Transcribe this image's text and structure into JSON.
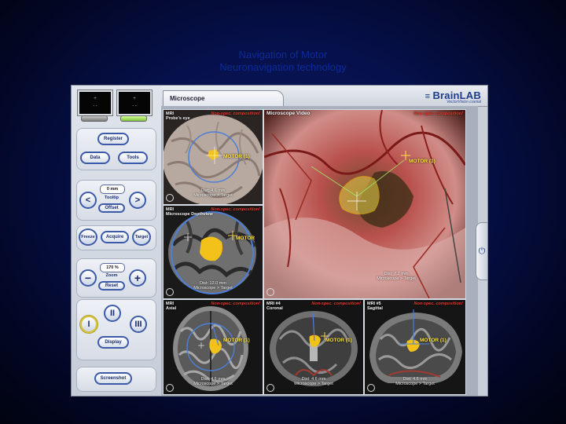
{
  "slide": {
    "caption_line1": "Navigation of Motor",
    "caption_line2": "Neuronavigation technology"
  },
  "app": {
    "brand_name": "BrainLAB",
    "brand_sub": "VectorVision cranial",
    "active_tab": "Microscope"
  },
  "left_panel": {
    "register_label": "Register",
    "data_label": "Data",
    "tools_label": "Tools",
    "tooltip_value": "0 mm",
    "tooltip_label": "Tooltip",
    "offset_label": "Offset",
    "freeze_label": "Freeze",
    "acquire_label": "Acquire",
    "target_label": "Target",
    "zoom_value": "170 %",
    "zoom_label": "Zoom",
    "reset_label": "Reset",
    "layout_1": "I",
    "layout_2": "II",
    "layout_3": "III",
    "display_label": "Display",
    "screenshot_label": "Screenshot",
    "minus_symbol": "−",
    "plus_symbol": "+",
    "left_arrow": "<",
    "right_arrow": ">"
  },
  "panes": {
    "pane1": {
      "title": "MRI",
      "subtitle": "Probe's eye",
      "warning": "Non-spec. composition!",
      "motor": "MOTOR (1)",
      "dist": "Dist: 4.6 mm",
      "info": "Microscope > Target"
    },
    "pane2": {
      "title": "MRI",
      "subtitle": "Microscope Depthview",
      "warning": "Non-spec. composition!",
      "motor": "MOTOR",
      "dist": "Dist: 12.0 mm",
      "info": "Microscope > Target"
    },
    "video": {
      "title": "Microscope Video",
      "warning": "Non-spec. composition!",
      "motor": "MOTOR (1)",
      "dist": "Dist: 7.2 mm",
      "info": "Microscope > Target"
    },
    "axial": {
      "title": "MRI",
      "subtitle": "Axial",
      "warning": "Non-spec. composition!",
      "motor": "MOTOR (1)",
      "dist": "Dist: 4.6 mm",
      "info": "Microscope > Target"
    },
    "coronal": {
      "title": "MRI #4",
      "subtitle": "Coronal",
      "warning": "Non-spec. composition!",
      "motor": "MOTOR (1)",
      "dist": "Dist: 4.6 mm",
      "info": "Microscope > Target"
    },
    "sagittal": {
      "title": "MRI #5",
      "subtitle": "Sagittal",
      "warning": "Non-spec. composition!",
      "motor": "MOTOR (1)",
      "dist": "Dist: 4.6 mm",
      "info": "Microscope > Target"
    }
  },
  "colors": {
    "accent_blue": "#3c5aa8",
    "tumor_yellow": "#f2c21b",
    "warning_red": "#e23b2b",
    "power_icon": "power-icon"
  }
}
